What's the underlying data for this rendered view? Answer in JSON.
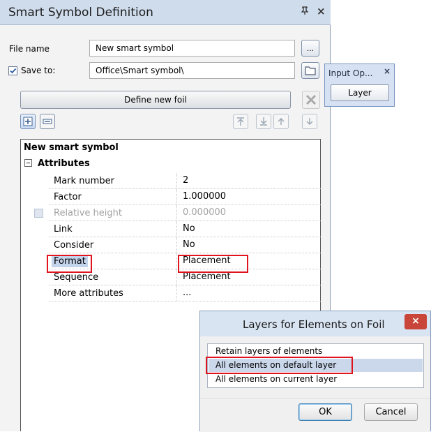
{
  "panel": {
    "title": "Smart Symbol Definition",
    "file_name_label": "File name",
    "file_name_value": "New smart symbol",
    "browse_label": "...",
    "save_to_label": "Save to:",
    "save_to_checked": true,
    "save_to_value": "Office\\Smart symbol\\",
    "define_foil_label": "Define new foil"
  },
  "grid": {
    "title": "New smart symbol",
    "section": "Attributes",
    "rows": [
      {
        "key": "Mark number",
        "value": "2",
        "disabled": false
      },
      {
        "key": "Factor",
        "value": "1.000000",
        "disabled": false
      },
      {
        "key": "Relative height",
        "value": "0.000000",
        "disabled": true
      },
      {
        "key": "Link",
        "value": "No",
        "disabled": false
      },
      {
        "key": "Consider",
        "value": "No",
        "disabled": false
      },
      {
        "key": "Format",
        "value": "Placement",
        "disabled": false
      },
      {
        "key": "Sequence",
        "value": "Placement",
        "disabled": false
      },
      {
        "key": "More attributes",
        "value": "...",
        "disabled": false
      }
    ]
  },
  "input_options": {
    "title": "Input Op...",
    "close": "×",
    "layer_button": "Layer"
  },
  "layers_dialog": {
    "title": "Layers for Elements on Foil",
    "close": "×",
    "options": [
      "Retain layers of elements",
      "All elements on default layer",
      "All elements on current layer"
    ],
    "selected_index": 1,
    "ok_label": "OK",
    "cancel_label": "Cancel"
  },
  "colors": {
    "highlight_red": "#e0141c",
    "selection_blue": "#cbd8ec"
  },
  "icons": {
    "pin": "pin-icon",
    "folder": "folder-icon",
    "delete": "delete-x-icon",
    "add": "add-foil-icon",
    "remove": "remove-foil-icon",
    "move_top": "move-top-icon",
    "move_bottom": "move-bottom-icon",
    "move_up": "move-up-icon",
    "move_down": "move-down-icon"
  }
}
